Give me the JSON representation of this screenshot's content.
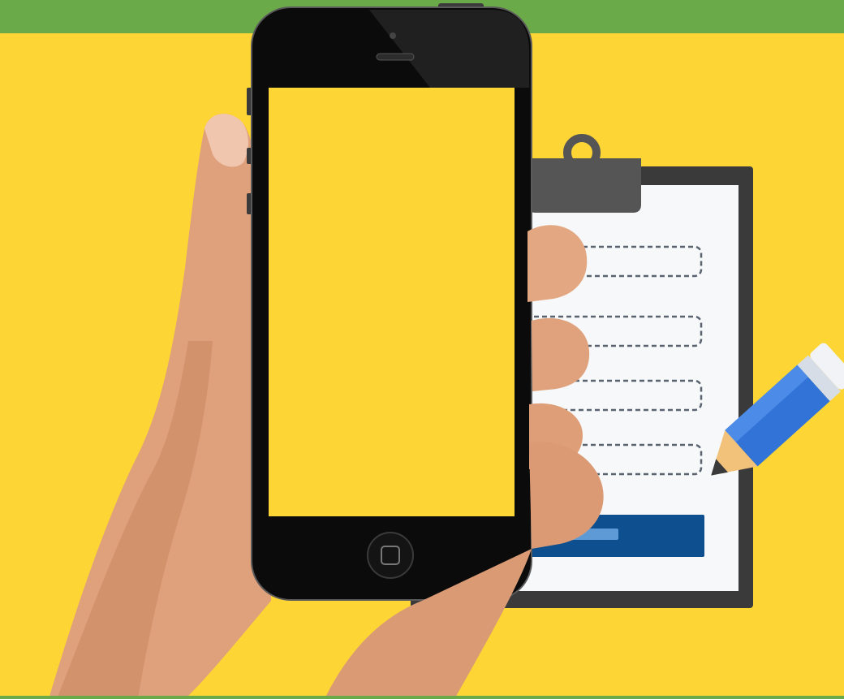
{
  "colors": {
    "background": "#FDD535",
    "header_bar": "#6BAA48",
    "clipboard_frame": "#3A3A3A",
    "clipboard_paper": "#F6F8F9",
    "field_fill": "#8DBBE3",
    "field_border": "#5A6470",
    "submit_button": "#0E4F8F",
    "pencil_body": "#3173D6",
    "phone_body": "#0B0B0B",
    "phone_screen": "#FDD535",
    "skin": "#E0A07A"
  },
  "icons": {
    "clipboard": "clipboard-form-icon",
    "pencil": "pencil-icon",
    "phone": "smartphone",
    "home_button": "home-button-icon"
  },
  "form": {
    "field_count": 4,
    "has_submit_button": true
  }
}
